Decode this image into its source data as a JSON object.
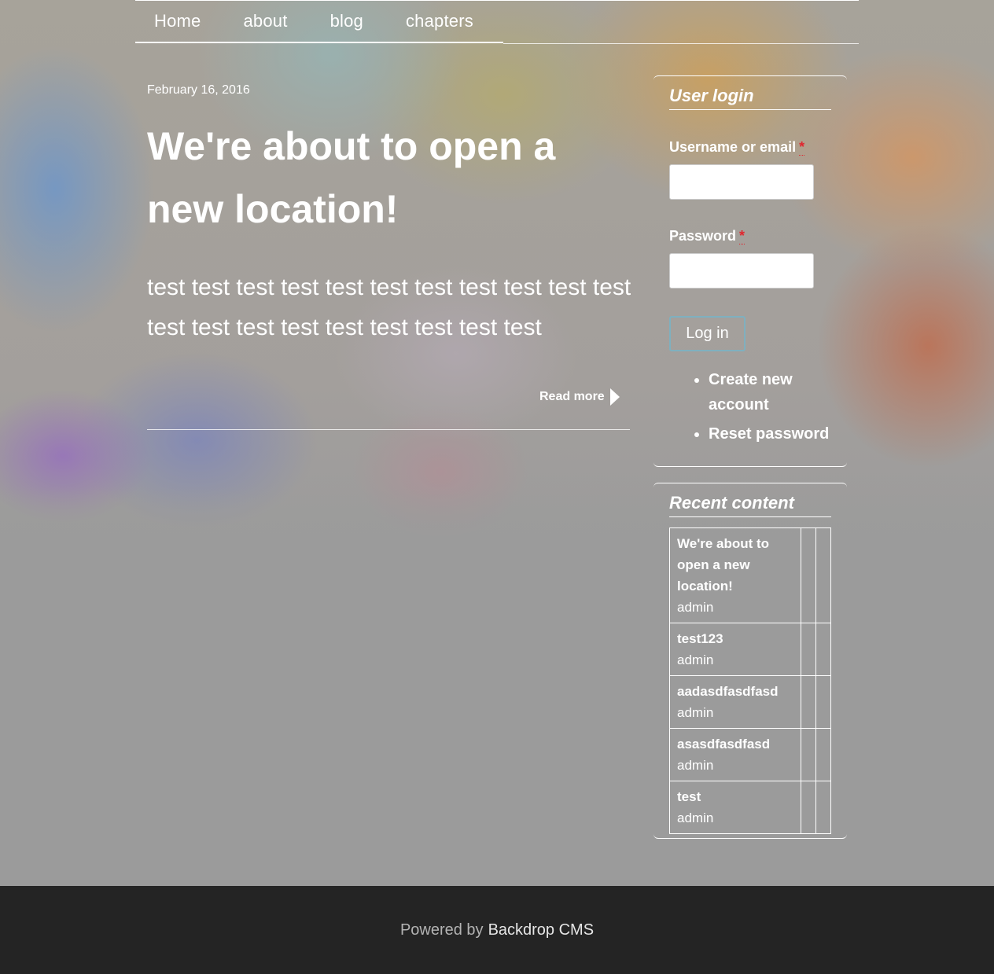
{
  "nav": {
    "items": [
      {
        "label": "Home"
      },
      {
        "label": "about"
      },
      {
        "label": "blog"
      },
      {
        "label": "chapters"
      }
    ]
  },
  "article": {
    "date": "February 16, 2016",
    "title": "We're about to open a new location!",
    "body": "test test test test test test test test test test test test test test test test test test test test",
    "read_more": "Read more"
  },
  "login": {
    "title": "User login",
    "username_label": "Username or email",
    "password_label": "Password",
    "required_marker": "*",
    "username_value": "",
    "password_value": "",
    "submit_label": "Log in",
    "links": [
      {
        "label": "Create new account"
      },
      {
        "label": "Reset password"
      }
    ]
  },
  "recent": {
    "title": "Recent content",
    "rows": [
      {
        "title": "We're about to open a new location!",
        "author": "admin"
      },
      {
        "title": "test123",
        "author": "admin"
      },
      {
        "title": "aadasdfasdfasd",
        "author": "admin"
      },
      {
        "title": "asasdfasdfasd",
        "author": "admin"
      },
      {
        "title": "test",
        "author": "admin"
      }
    ]
  },
  "footer": {
    "prefix": "Powered by",
    "link": "Backdrop CMS"
  },
  "colors": {
    "page_background": "#9b9b9b",
    "footer_background": "#242424",
    "required_marker": "#e0262e",
    "button_border": "#7fb0bf"
  }
}
